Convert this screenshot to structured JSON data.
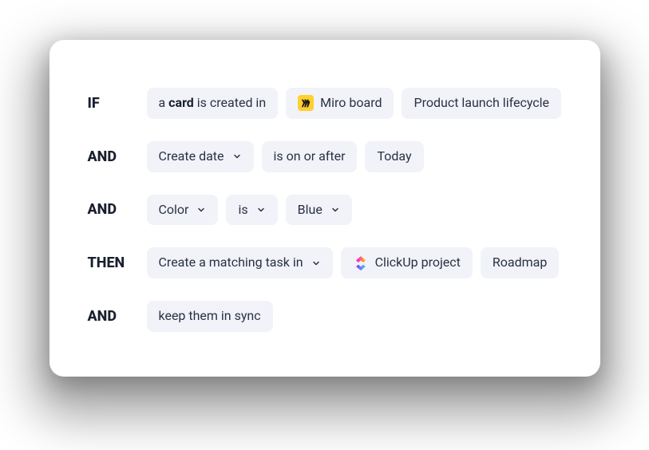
{
  "rows": [
    {
      "keyword": "IF",
      "pills": {
        "trigger_pre": "a ",
        "trigger_bold": "card",
        "trigger_post": " is created in",
        "source_app": "Miro board",
        "source_name": "Product launch lifecycle"
      }
    },
    {
      "keyword": "AND",
      "pills": {
        "field": "Create date",
        "operator": "is on or after",
        "value": "Today"
      }
    },
    {
      "keyword": "AND",
      "pills": {
        "field": "Color",
        "operator": "is",
        "value": "Blue"
      }
    },
    {
      "keyword": "THEN",
      "pills": {
        "action": "Create a matching task in",
        "target_app": "ClickUp project",
        "target_name": "Roadmap"
      }
    },
    {
      "keyword": "AND",
      "pills": {
        "action": "keep them in sync"
      }
    }
  ]
}
